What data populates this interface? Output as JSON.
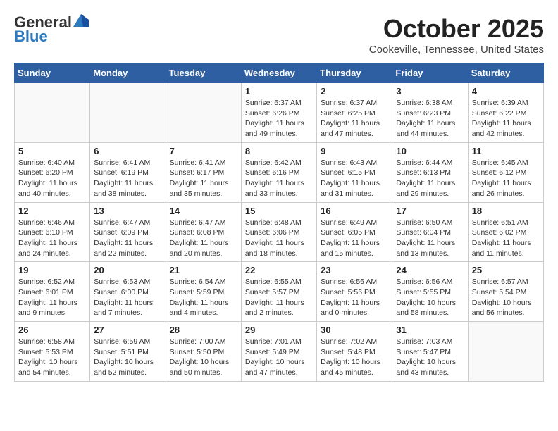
{
  "header": {
    "logo_line1": "General",
    "logo_line2": "Blue",
    "month": "October 2025",
    "location": "Cookeville, Tennessee, United States"
  },
  "weekdays": [
    "Sunday",
    "Monday",
    "Tuesday",
    "Wednesday",
    "Thursday",
    "Friday",
    "Saturday"
  ],
  "weeks": [
    [
      {
        "day": "",
        "info": ""
      },
      {
        "day": "",
        "info": ""
      },
      {
        "day": "",
        "info": ""
      },
      {
        "day": "1",
        "info": "Sunrise: 6:37 AM\nSunset: 6:26 PM\nDaylight: 11 hours\nand 49 minutes."
      },
      {
        "day": "2",
        "info": "Sunrise: 6:37 AM\nSunset: 6:25 PM\nDaylight: 11 hours\nand 47 minutes."
      },
      {
        "day": "3",
        "info": "Sunrise: 6:38 AM\nSunset: 6:23 PM\nDaylight: 11 hours\nand 44 minutes."
      },
      {
        "day": "4",
        "info": "Sunrise: 6:39 AM\nSunset: 6:22 PM\nDaylight: 11 hours\nand 42 minutes."
      }
    ],
    [
      {
        "day": "5",
        "info": "Sunrise: 6:40 AM\nSunset: 6:20 PM\nDaylight: 11 hours\nand 40 minutes."
      },
      {
        "day": "6",
        "info": "Sunrise: 6:41 AM\nSunset: 6:19 PM\nDaylight: 11 hours\nand 38 minutes."
      },
      {
        "day": "7",
        "info": "Sunrise: 6:41 AM\nSunset: 6:17 PM\nDaylight: 11 hours\nand 35 minutes."
      },
      {
        "day": "8",
        "info": "Sunrise: 6:42 AM\nSunset: 6:16 PM\nDaylight: 11 hours\nand 33 minutes."
      },
      {
        "day": "9",
        "info": "Sunrise: 6:43 AM\nSunset: 6:15 PM\nDaylight: 11 hours\nand 31 minutes."
      },
      {
        "day": "10",
        "info": "Sunrise: 6:44 AM\nSunset: 6:13 PM\nDaylight: 11 hours\nand 29 minutes."
      },
      {
        "day": "11",
        "info": "Sunrise: 6:45 AM\nSunset: 6:12 PM\nDaylight: 11 hours\nand 26 minutes."
      }
    ],
    [
      {
        "day": "12",
        "info": "Sunrise: 6:46 AM\nSunset: 6:10 PM\nDaylight: 11 hours\nand 24 minutes."
      },
      {
        "day": "13",
        "info": "Sunrise: 6:47 AM\nSunset: 6:09 PM\nDaylight: 11 hours\nand 22 minutes."
      },
      {
        "day": "14",
        "info": "Sunrise: 6:47 AM\nSunset: 6:08 PM\nDaylight: 11 hours\nand 20 minutes."
      },
      {
        "day": "15",
        "info": "Sunrise: 6:48 AM\nSunset: 6:06 PM\nDaylight: 11 hours\nand 18 minutes."
      },
      {
        "day": "16",
        "info": "Sunrise: 6:49 AM\nSunset: 6:05 PM\nDaylight: 11 hours\nand 15 minutes."
      },
      {
        "day": "17",
        "info": "Sunrise: 6:50 AM\nSunset: 6:04 PM\nDaylight: 11 hours\nand 13 minutes."
      },
      {
        "day": "18",
        "info": "Sunrise: 6:51 AM\nSunset: 6:02 PM\nDaylight: 11 hours\nand 11 minutes."
      }
    ],
    [
      {
        "day": "19",
        "info": "Sunrise: 6:52 AM\nSunset: 6:01 PM\nDaylight: 11 hours\nand 9 minutes."
      },
      {
        "day": "20",
        "info": "Sunrise: 6:53 AM\nSunset: 6:00 PM\nDaylight: 11 hours\nand 7 minutes."
      },
      {
        "day": "21",
        "info": "Sunrise: 6:54 AM\nSunset: 5:59 PM\nDaylight: 11 hours\nand 4 minutes."
      },
      {
        "day": "22",
        "info": "Sunrise: 6:55 AM\nSunset: 5:57 PM\nDaylight: 11 hours\nand 2 minutes."
      },
      {
        "day": "23",
        "info": "Sunrise: 6:56 AM\nSunset: 5:56 PM\nDaylight: 11 hours\nand 0 minutes."
      },
      {
        "day": "24",
        "info": "Sunrise: 6:56 AM\nSunset: 5:55 PM\nDaylight: 10 hours\nand 58 minutes."
      },
      {
        "day": "25",
        "info": "Sunrise: 6:57 AM\nSunset: 5:54 PM\nDaylight: 10 hours\nand 56 minutes."
      }
    ],
    [
      {
        "day": "26",
        "info": "Sunrise: 6:58 AM\nSunset: 5:53 PM\nDaylight: 10 hours\nand 54 minutes."
      },
      {
        "day": "27",
        "info": "Sunrise: 6:59 AM\nSunset: 5:51 PM\nDaylight: 10 hours\nand 52 minutes."
      },
      {
        "day": "28",
        "info": "Sunrise: 7:00 AM\nSunset: 5:50 PM\nDaylight: 10 hours\nand 50 minutes."
      },
      {
        "day": "29",
        "info": "Sunrise: 7:01 AM\nSunset: 5:49 PM\nDaylight: 10 hours\nand 47 minutes."
      },
      {
        "day": "30",
        "info": "Sunrise: 7:02 AM\nSunset: 5:48 PM\nDaylight: 10 hours\nand 45 minutes."
      },
      {
        "day": "31",
        "info": "Sunrise: 7:03 AM\nSunset: 5:47 PM\nDaylight: 10 hours\nand 43 minutes."
      },
      {
        "day": "",
        "info": ""
      }
    ]
  ]
}
